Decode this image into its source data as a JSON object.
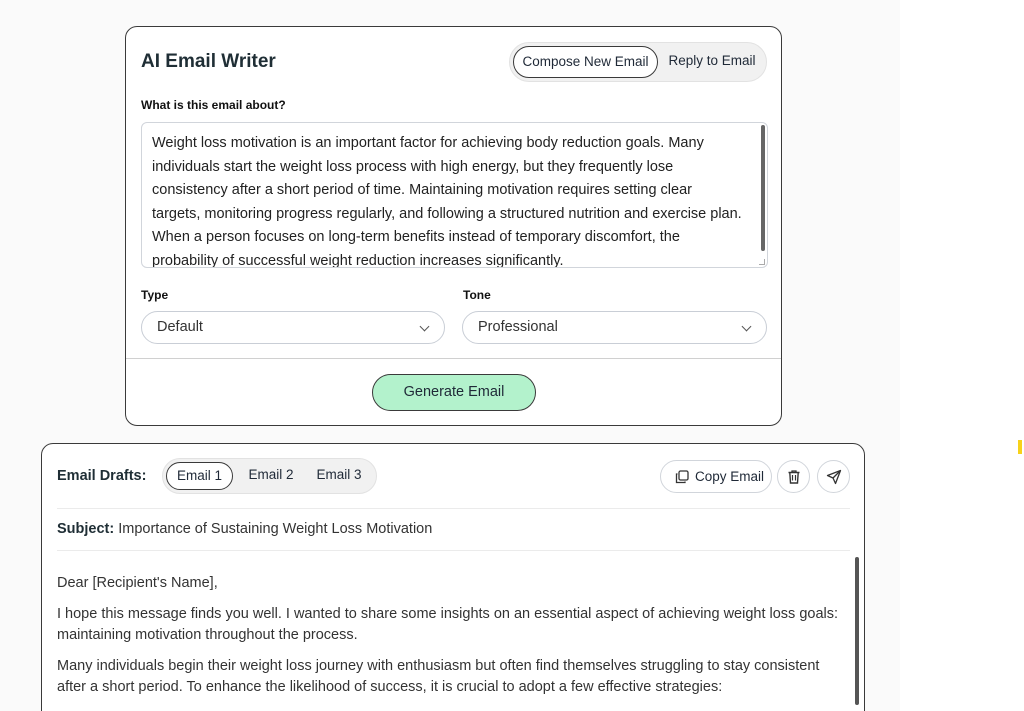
{
  "writer": {
    "title": "AI Email Writer",
    "modes": {
      "compose": "Compose New Email",
      "reply": "Reply to Email",
      "active": "compose"
    },
    "about_label": "What is this email about?",
    "about_value": "Weight loss motivation is an important factor for achieving body reduction goals. Many individuals start the weight loss process with high energy, but they frequently lose consistency after a short period of time. Maintaining motivation requires setting clear targets, monitoring progress regularly, and following a structured nutrition and exercise plan. When a person focuses on long-term benefits instead of temporary discomfort, the probability of successful weight reduction increases significantly.",
    "type_label": "Type",
    "type_value": "Default",
    "tone_label": "Tone",
    "tone_value": "Professional",
    "generate_label": "Generate Email"
  },
  "drafts": {
    "label": "Email Drafts:",
    "tabs": [
      "Email 1",
      "Email 2",
      "Email 3"
    ],
    "active_tab": "Email 1",
    "copy_label": "Copy Email",
    "subject_label": "Subject:",
    "subject_value": "Importance of Sustaining Weight Loss Motivation",
    "paragraphs": [
      "Dear [Recipient's Name],",
      "I hope this message finds you well. I wanted to share some insights on an essential aspect of achieving weight loss goals: maintaining motivation throughout the process.",
      "Many individuals begin their weight loss journey with enthusiasm but often find themselves struggling to stay consistent after a short period. To enhance the likelihood of success, it is crucial to adopt a few effective strategies:"
    ]
  },
  "icons": {
    "chevron": "chevron-down-icon",
    "copy": "copy-icon",
    "trash": "trash-icon",
    "send": "send-icon"
  },
  "colors": {
    "accent": "#b3f2cc",
    "border_dark": "#3a3a3a",
    "marker": "#f7d21a"
  }
}
